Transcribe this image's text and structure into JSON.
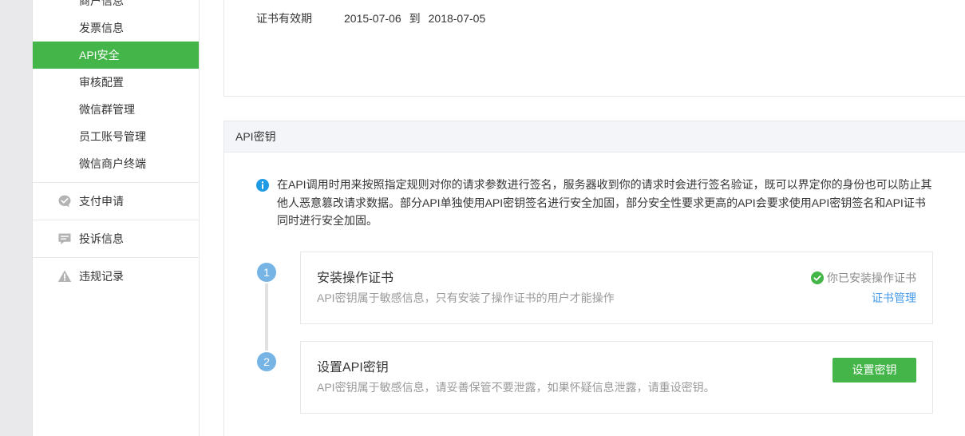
{
  "colors": {
    "accent": "#44b549",
    "link": "#459ae9",
    "info": "#1f9be6",
    "step": "#76b4e6",
    "text": "#353535",
    "muted": "#9a9a9a",
    "border": "#e7e7eb",
    "header_bg": "#f4f5f9",
    "icon_gray": "#b3b3b3",
    "gutter": "#e9e9ec"
  },
  "sidebar": {
    "items": [
      {
        "label": "商户信息"
      },
      {
        "label": "发票信息"
      },
      {
        "label": "API安全",
        "active": true
      },
      {
        "label": "审核配置"
      },
      {
        "label": "微信群管理"
      },
      {
        "label": "员工账号管理"
      },
      {
        "label": "微信商户终端"
      }
    ],
    "groups": [
      {
        "label": "支付申请",
        "icon": "payment-check-icon"
      },
      {
        "label": "投诉信息",
        "icon": "complaint-message-icon"
      },
      {
        "label": "违规记录",
        "icon": "warning-icon"
      }
    ]
  },
  "certificate": {
    "validity_label": "证书有效期",
    "start_date": "2015-07-06",
    "range_separator": "到",
    "end_date": "2018-07-05"
  },
  "api_key": {
    "title": "API密钥",
    "info_icon": "info-icon",
    "info_lines": [
      "在API调用时用来按照指定规则对你的请求参数进行签名，服务器收到你的请求时会进行签名验证，既可以界定你的身份也可以防止其",
      "他人恶意篡改请求数据。部分API单独使用API密钥签名进行安全加固，部分安全性要求更高的API会要求使用API密钥签名和API证书",
      "同时进行安全加固。"
    ],
    "steps": [
      {
        "number": "1",
        "title": "安装操作证书",
        "description": "API密钥属于敏感信息，只有安装了操作证书的用户才能操作",
        "status_icon": "check-circle-icon",
        "status": "你已安装操作证书",
        "link": "证书管理"
      },
      {
        "number": "2",
        "title": "设置API密钥",
        "description": "API密钥属于敏感信息，请妥善保管不要泄露，如果怀疑信息泄露，请重设密钥。",
        "button": "设置密钥"
      }
    ]
  }
}
